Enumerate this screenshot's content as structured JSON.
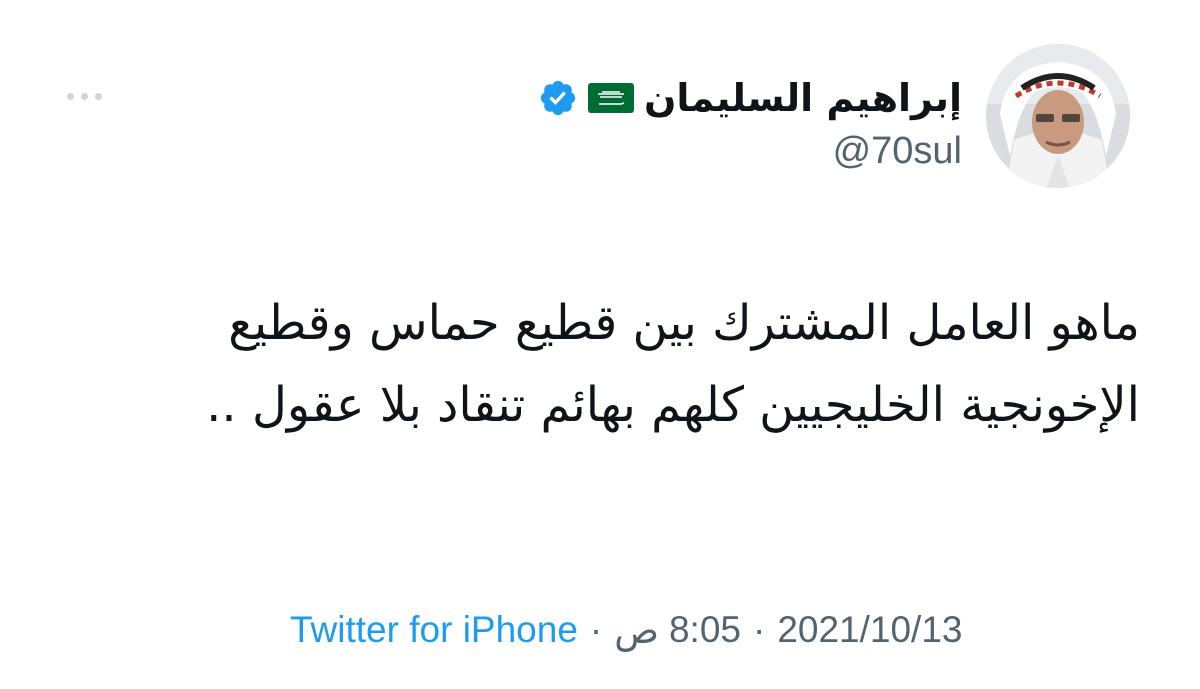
{
  "author": {
    "display_name": "إبراهيم السليمان",
    "handle": "@70sul",
    "verified": true,
    "flag": "saudi-arabia-flag"
  },
  "tweet": {
    "text": "ماهو العامل المشترك بين قطيع حماس وقطيع الإخونجية الخليجيين كلهم بهائم تنقاد بلا عقول ..",
    "date": "2021/10/13",
    "time": "8:05",
    "period": "ص",
    "separator": "·",
    "source": "Twitter for iPhone"
  },
  "colors": {
    "link": "#1d9bf0",
    "secondary_text": "#536471",
    "primary_text": "#0f1419",
    "flag_green": "#006c35",
    "verified_blue": "#1d9bf0"
  },
  "icons": {
    "more": "more-horizontal-icon",
    "verified": "verified-badge-icon"
  }
}
